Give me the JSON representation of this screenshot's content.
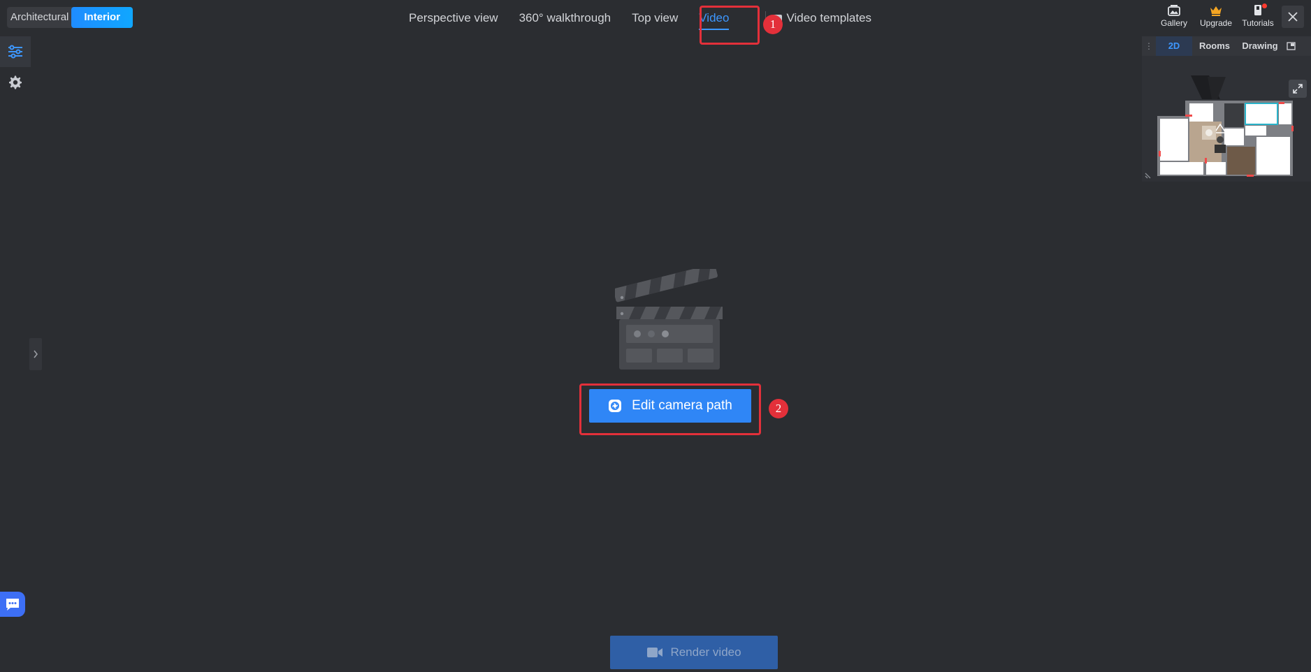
{
  "modes": [
    {
      "label": "Architectural",
      "active": false
    },
    {
      "label": "Interior",
      "active": true
    }
  ],
  "view_tabs": [
    {
      "label": "Perspective view"
    },
    {
      "label": "360° walkthrough"
    },
    {
      "label": "Top view"
    },
    {
      "label": "Video",
      "active": true
    }
  ],
  "video_templates_label": "Video templates",
  "header_actions": {
    "gallery": "Gallery",
    "upgrade": "Upgrade",
    "tutorials": "Tutorials"
  },
  "minimap": {
    "tabs": [
      {
        "label": "2D",
        "active": true
      },
      {
        "label": "Rooms"
      },
      {
        "label": "Drawing"
      }
    ]
  },
  "annotations": {
    "step1": "1",
    "step2": "2"
  },
  "edit_camera_path_label": "Edit camera path",
  "render_video_label": "Render video",
  "colors": {
    "background": "#2b2d31",
    "accent": "#2f86f6",
    "highlight": "#e3303a",
    "render_button": "#2f5fa6"
  }
}
